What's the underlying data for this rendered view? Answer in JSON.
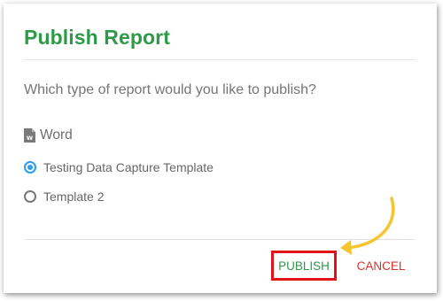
{
  "dialog": {
    "title": "Publish Report",
    "question": "Which type of report would you like to publish?",
    "format": {
      "icon": "word-document-icon",
      "label": "Word"
    },
    "options": [
      {
        "label": "Testing Data Capture Template",
        "selected": true
      },
      {
        "label": "Template 2",
        "selected": false
      }
    ],
    "actions": {
      "publish_label": "PUBLISH",
      "cancel_label": "CANCEL"
    }
  },
  "colors": {
    "title": "#2e9a48",
    "publish_text": "#2e9a48",
    "publish_highlight": "#e3131a",
    "cancel_text": "#d9332e",
    "radio_selected": "#2a9df4",
    "annotation_arrow": "#f5c430"
  }
}
